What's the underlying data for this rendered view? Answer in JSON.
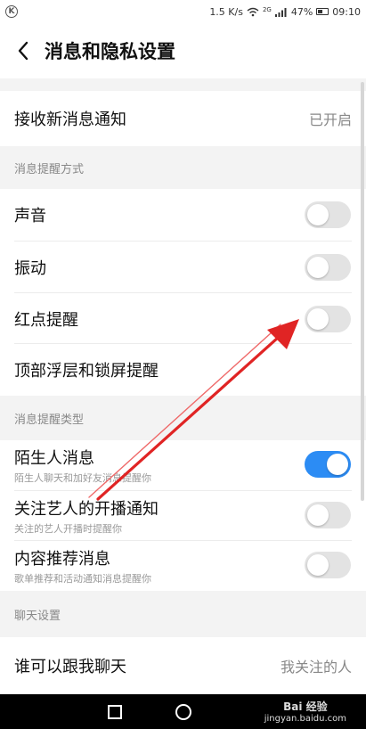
{
  "status_bar": {
    "speed": "1.5 K/s",
    "signal_label": "2G",
    "battery": "47%",
    "time": "09:10"
  },
  "header": {
    "title": "消息和隐私设置"
  },
  "receive": {
    "label": "接收新消息通知",
    "value": "已开启"
  },
  "section_alert_method": {
    "title": "消息提醒方式",
    "items": [
      {
        "label": "声音",
        "enabled": false
      },
      {
        "label": "振动",
        "enabled": false
      },
      {
        "label": "红点提醒",
        "enabled": false
      },
      {
        "label": "顶部浮层和锁屏提醒"
      }
    ]
  },
  "section_alert_type": {
    "title": "消息提醒类型",
    "items": [
      {
        "label": "陌生人消息",
        "sub": "陌生人聊天和加好友消息提醒你",
        "enabled": true
      },
      {
        "label": "关注艺人的开播通知",
        "sub": "关注的艺人开播时提醒你",
        "enabled": false
      },
      {
        "label": "内容推荐消息",
        "sub": "歌单推荐和活动通知消息提醒你",
        "enabled": false
      }
    ]
  },
  "section_chat": {
    "title": "聊天设置",
    "items": [
      {
        "label": "谁可以跟我聊天",
        "value": "我关注的人"
      }
    ]
  },
  "watermark": {
    "brand": "Bai 经验",
    "url": "jingyan.baidu.com"
  },
  "colors": {
    "toggle_on": "#2c8cf4",
    "annotation_arrow": "#e02424"
  }
}
